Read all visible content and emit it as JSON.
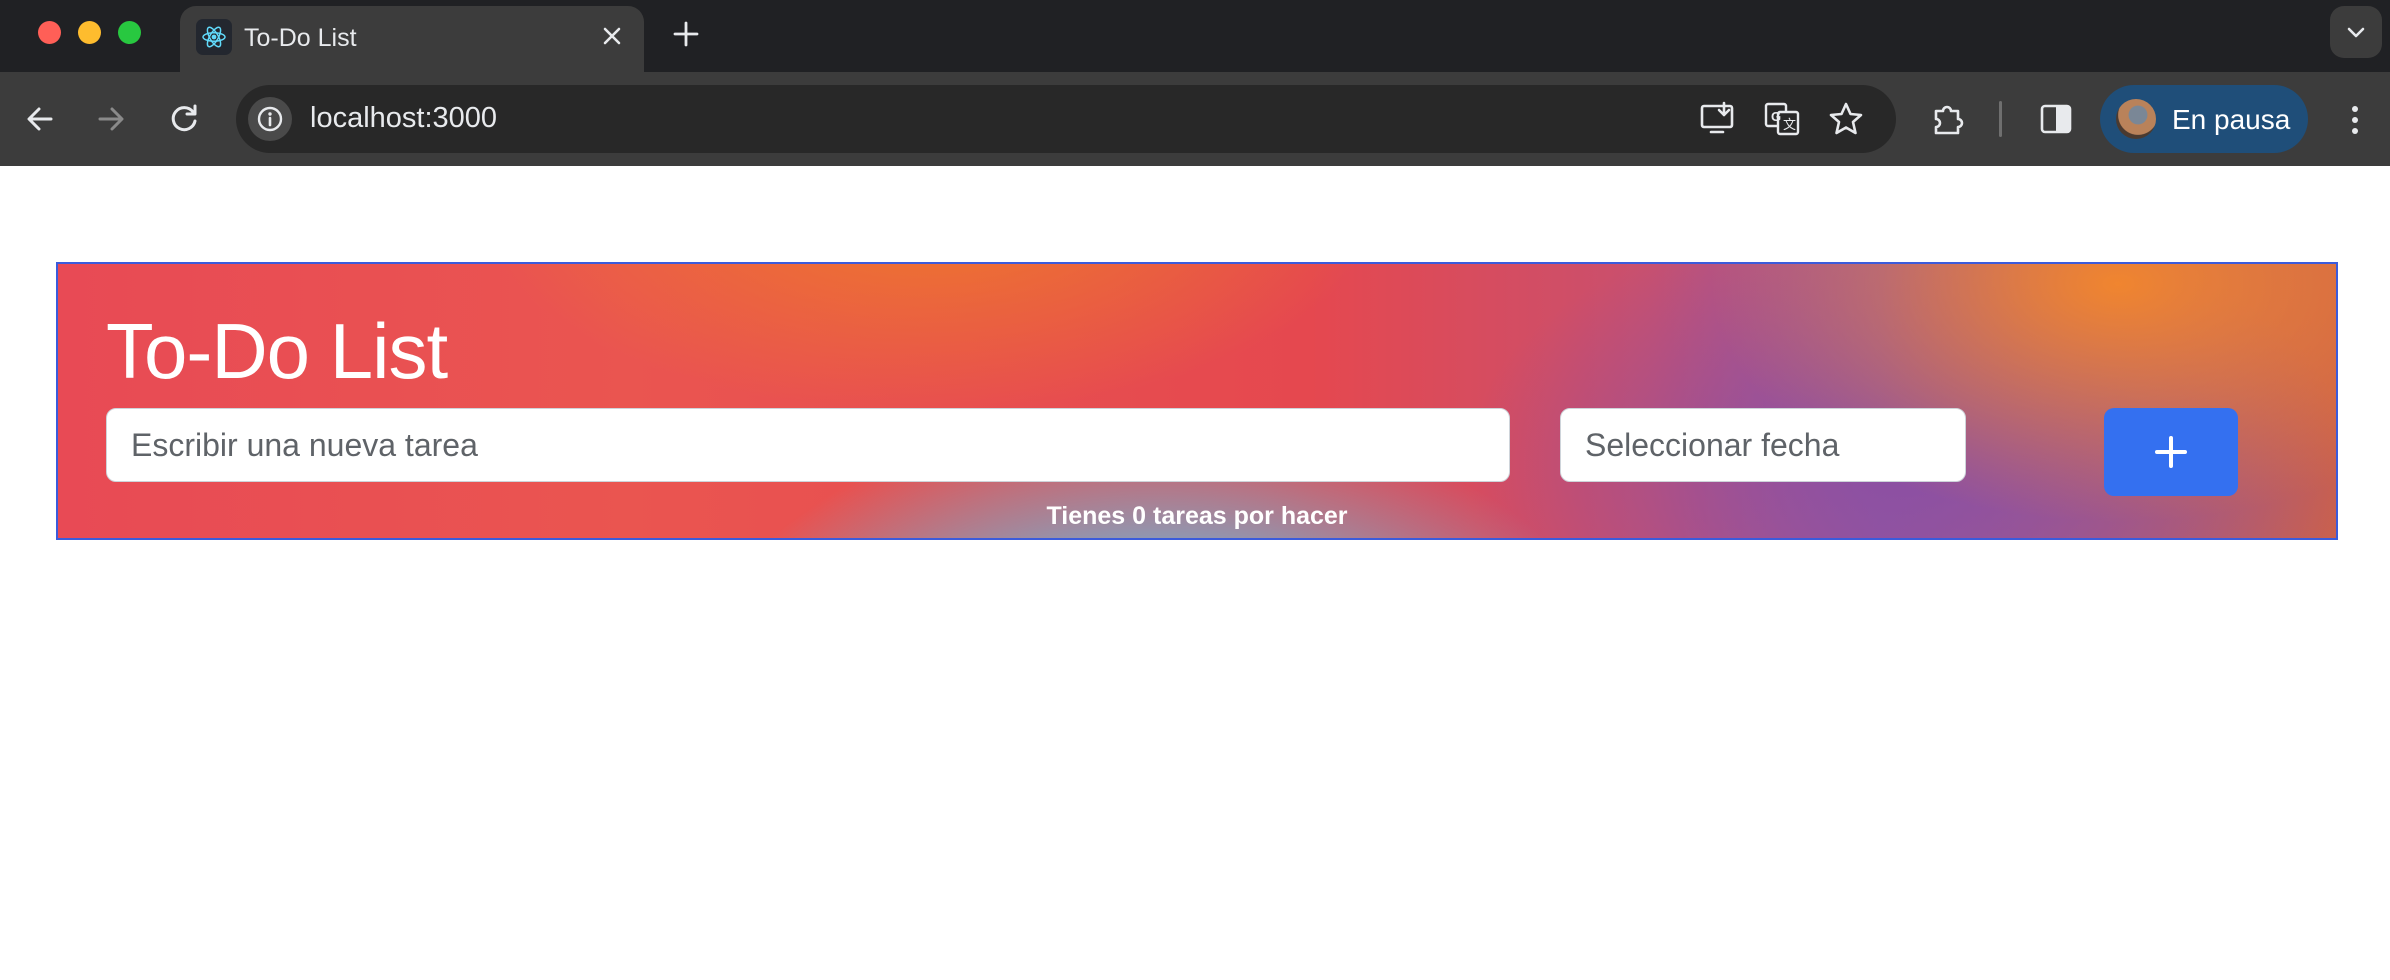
{
  "browser": {
    "tab": {
      "title": "To-Do List",
      "favicon": "react-icon"
    },
    "address_bar": {
      "url": "localhost:3000"
    },
    "profile": {
      "label": "En pausa"
    },
    "icons": [
      "back-arrow-icon",
      "forward-arrow-icon",
      "reload-icon",
      "site-info-icon",
      "install-app-icon",
      "translate-icon",
      "bookmark-star-icon",
      "extensions-icon",
      "side-panel-icon",
      "kebab-menu-icon",
      "tab-search-icon",
      "new-tab-icon",
      "close-icon"
    ]
  },
  "app": {
    "title": "To-Do List",
    "task_input": {
      "placeholder": "Escribir una nueva tarea",
      "value": ""
    },
    "date_input": {
      "placeholder": "Seleccionar fecha",
      "value": ""
    },
    "add_button": {
      "label": "+"
    },
    "counter_text": "Tienes 0 tareas por hacer"
  },
  "colors": {
    "accent_button": "#3470f0",
    "banner_border": "#3b5bdb",
    "profile_chip": "#1f4e79"
  }
}
